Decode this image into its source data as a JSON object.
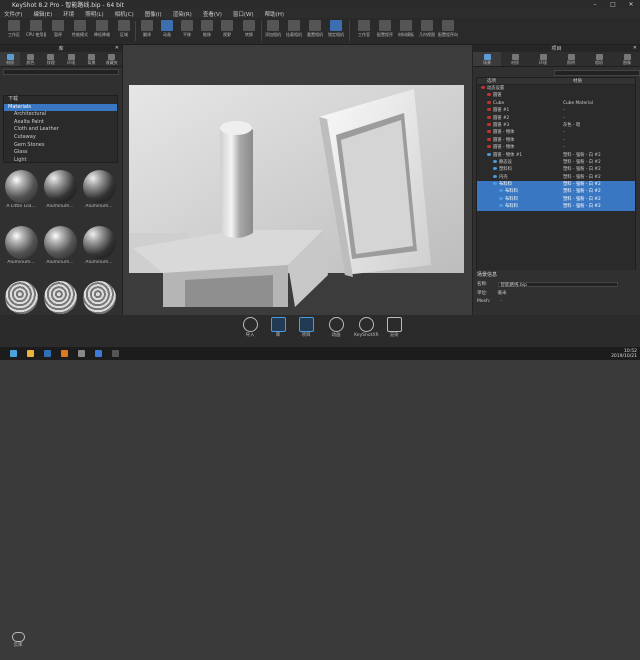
{
  "app": {
    "title": "KeyShot 8.2 Pro - 智能路线.bip - 64 bit"
  },
  "menu": [
    "文件(F)",
    "编辑(E)",
    "环境",
    "照明(L)",
    "相机(C)",
    "图像(I)",
    "渲染(R)",
    "查看(V)",
    "窗口(W)",
    "帮助(H)"
  ],
  "toolbar": {
    "items": [
      "工作区",
      "CPU 使用量",
      "暂停",
      "性能模式",
      "降低降噪",
      "区域",
      "翻译",
      "动画",
      "平移",
      "推移",
      "视野",
      "转换",
      "添加相机",
      "挂载相机",
      "重置相机",
      "锁定相机",
      "工作室",
      "配置程序",
      "材料模板",
      "几何视图",
      "配置程序向导"
    ]
  },
  "library": {
    "title": "库",
    "tabs": [
      "材质",
      "颜色",
      "纹理",
      "环境",
      "背景",
      "收藏夹"
    ],
    "tree": [
      "下载",
      "Materials",
      "Architectural",
      "Axalta Paint",
      "Cloth and Leather",
      "Cutaway",
      "Gem Stones",
      "Glass",
      "Light"
    ],
    "thumbs": [
      "A Little Lila...",
      "Aluminum...",
      "Aluminum...",
      "Aluminum...",
      "Aluminum...",
      "Aluminum...",
      "Aluminum...",
      "Aluminum...",
      "Aluminum..."
    ],
    "cloud_label": "云库"
  },
  "project": {
    "title": "项目",
    "tabs": [
      "场景",
      "材质",
      "环境",
      "照明",
      "相机",
      "图像"
    ],
    "columns": [
      "选项",
      "材质"
    ],
    "rows": [
      {
        "name": "动态设置",
        "mat": ""
      },
      {
        "name": "圆锥",
        "mat": ""
      },
      {
        "name": "Cube",
        "mat": "Cube Material"
      },
      {
        "name": "圆锥 #1",
        "mat": "-"
      },
      {
        "name": "圆锥 #2",
        "mat": "-"
      },
      {
        "name": "圆锥 #3",
        "mat": "灰色 - 暗"
      },
      {
        "name": "圆锥 - 物体",
        "mat": "-"
      },
      {
        "name": "圆锥 - 物体",
        "mat": "-"
      },
      {
        "name": "圆锥 - 物体",
        "mat": "-"
      },
      {
        "name": "圆锥 - 物体 #1",
        "mat": "塑料 - 强粉 - 白 #2"
      },
      {
        "name": "静态设",
        "mat": "塑料 - 强粉 - 白 #2"
      },
      {
        "name": "塑料料",
        "mat": "塑料 - 强粉 - 白 #2"
      },
      {
        "name": "内壳",
        "mat": "塑料 - 强粉 - 白 #2"
      },
      {
        "name": "布料料",
        "mat": "塑料 - 强粉 - 白 #2"
      },
      {
        "name": "布料料",
        "mat": "塑料 - 强粉 - 白 #2"
      },
      {
        "name": "布料料",
        "mat": "塑料 - 强粉 - 白 #2"
      },
      {
        "name": "布料料",
        "mat": "塑料 - 强粉 - 白 #2"
      }
    ],
    "bottom_tabs": [
      "场景",
      "材质"
    ]
  },
  "info": {
    "title": "场景信息",
    "name_label": "名称:",
    "name_value": "智能路线.bip",
    "unit_label": "单位:",
    "unit_value": "毫米",
    "dim_label": "Mesh:",
    "dim_value": "-"
  },
  "bottom": [
    "导入",
    "库",
    "项目",
    "动画",
    "KeyShotXR",
    "渲染"
  ],
  "clock": {
    "time": "10:52",
    "date": "2019/10/21"
  }
}
